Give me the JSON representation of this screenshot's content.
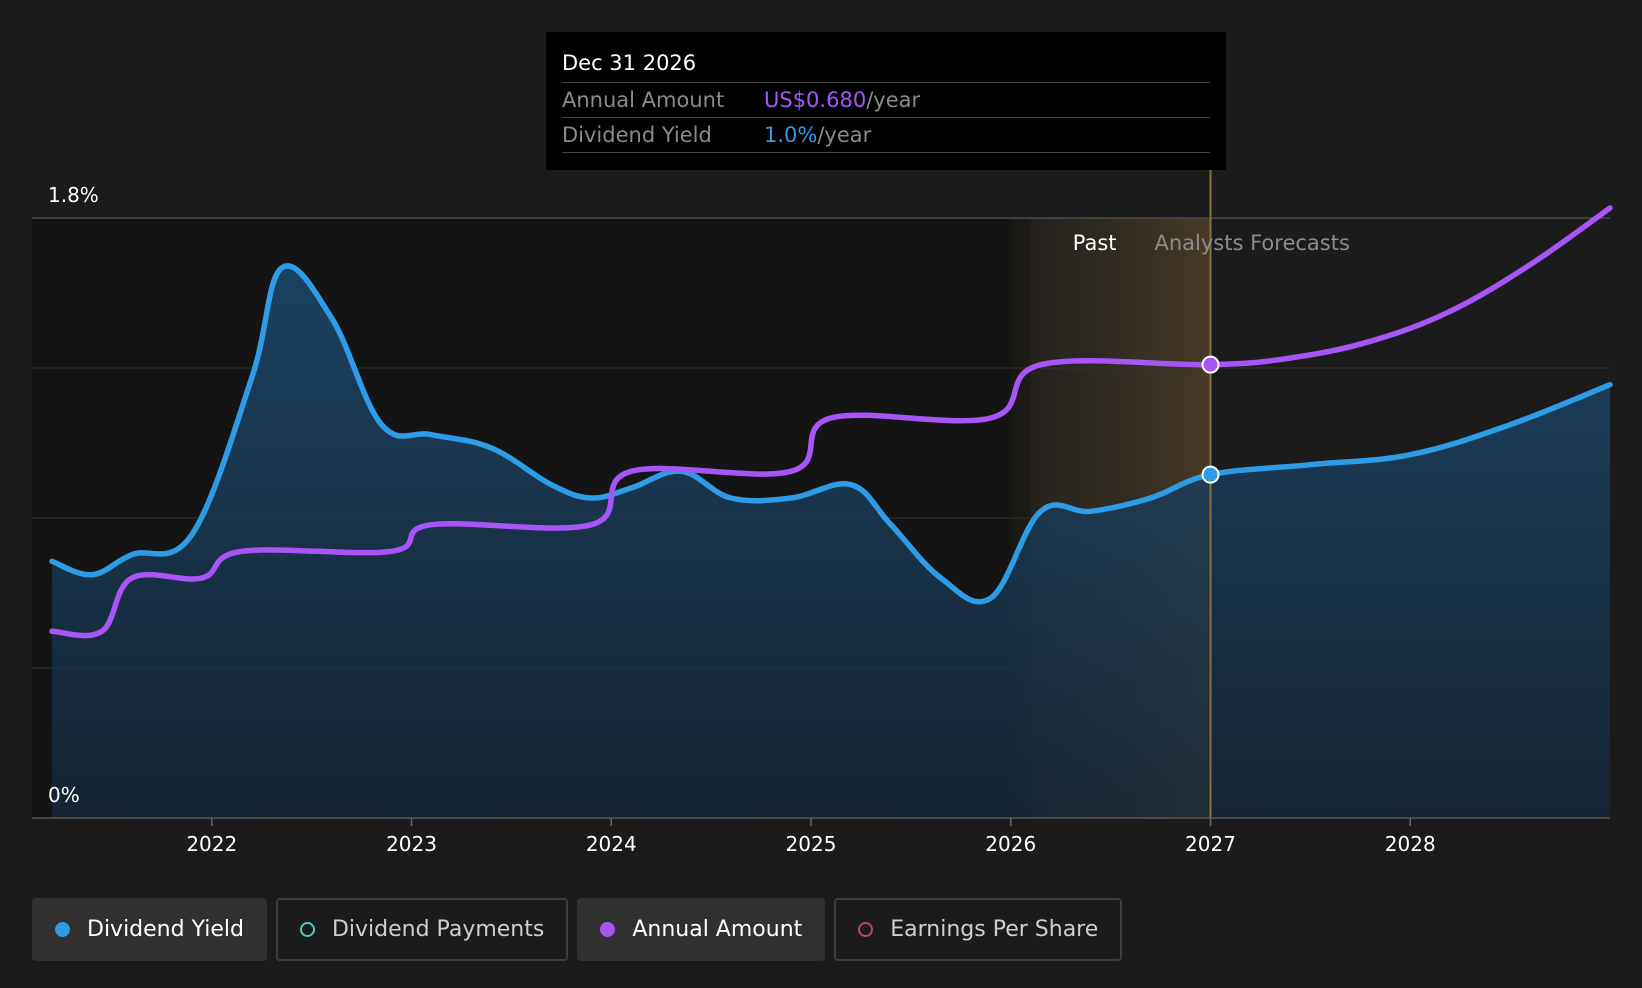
{
  "tooltip": {
    "date": "Dec 31 2026",
    "rows": [
      {
        "label": "Annual Amount",
        "value": "US$0.680",
        "unit": "/year",
        "color": "#a855f7"
      },
      {
        "label": "Dividend Yield",
        "value": "1.0%",
        "unit": "/year",
        "color": "#2d9be6"
      }
    ]
  },
  "legend": [
    {
      "label": "Dividend Yield",
      "color": "#2d9be6",
      "active": true,
      "filled": true
    },
    {
      "label": "Dividend Payments",
      "color": "#4fc8b8",
      "active": false,
      "filled": false
    },
    {
      "label": "Annual Amount",
      "color": "#a855f7",
      "active": true,
      "filled": true
    },
    {
      "label": "Earnings Per Share",
      "color": "#b8447e",
      "active": false,
      "filled": false
    }
  ],
  "chart_data": {
    "type": "line",
    "y_tick_labels": [
      "1.8%",
      "0%"
    ],
    "ylim": [
      0,
      1.8
    ],
    "xlim": [
      2021.1,
      2029.0
    ],
    "x_ticks": [
      2022,
      2023,
      2024,
      2025,
      2026,
      2027,
      2028
    ],
    "x_tick_labels": [
      "2022",
      "2023",
      "2024",
      "2025",
      "2026",
      "2027",
      "2028"
    ],
    "past_label": "Past",
    "forecast_label": "Analysts Forecasts",
    "highlight_region": [
      2026.0,
      2027.0
    ],
    "marker_x": 2027.0,
    "grid": true,
    "series": [
      {
        "name": "Dividend Yield",
        "color": "#2d9be6",
        "points": [
          [
            2021.2,
            0.77
          ],
          [
            2021.4,
            0.73
          ],
          [
            2021.6,
            0.79
          ],
          [
            2021.9,
            0.85
          ],
          [
            2022.2,
            1.32
          ],
          [
            2022.35,
            1.65
          ],
          [
            2022.6,
            1.5
          ],
          [
            2022.85,
            1.18
          ],
          [
            2023.1,
            1.15
          ],
          [
            2023.4,
            1.11
          ],
          [
            2023.7,
            1.0
          ],
          [
            2023.9,
            0.96
          ],
          [
            2024.1,
            0.99
          ],
          [
            2024.35,
            1.04
          ],
          [
            2024.6,
            0.96
          ],
          [
            2024.9,
            0.96
          ],
          [
            2025.2,
            1.0
          ],
          [
            2025.4,
            0.88
          ],
          [
            2025.65,
            0.72
          ],
          [
            2025.9,
            0.66
          ],
          [
            2026.15,
            0.92
          ],
          [
            2026.4,
            0.92
          ],
          [
            2026.7,
            0.96
          ],
          [
            2027.0,
            1.03
          ],
          [
            2027.5,
            1.06
          ],
          [
            2028.0,
            1.09
          ],
          [
            2028.5,
            1.18
          ],
          [
            2029.0,
            1.3
          ]
        ]
      },
      {
        "name": "Annual Amount",
        "color": "#a855f7",
        "points": [
          [
            2021.2,
            0.56
          ],
          [
            2021.45,
            0.56
          ],
          [
            2021.6,
            0.72
          ],
          [
            2021.95,
            0.72
          ],
          [
            2022.15,
            0.8
          ],
          [
            2022.9,
            0.8
          ],
          [
            2023.1,
            0.88
          ],
          [
            2023.9,
            0.88
          ],
          [
            2024.1,
            1.04
          ],
          [
            2024.9,
            1.04
          ],
          [
            2025.1,
            1.2
          ],
          [
            2025.9,
            1.2
          ],
          [
            2026.15,
            1.36
          ],
          [
            2027.0,
            1.36
          ],
          [
            2027.4,
            1.38
          ],
          [
            2027.8,
            1.43
          ],
          [
            2028.2,
            1.52
          ],
          [
            2028.6,
            1.66
          ],
          [
            2029.0,
            1.83
          ]
        ]
      }
    ]
  }
}
